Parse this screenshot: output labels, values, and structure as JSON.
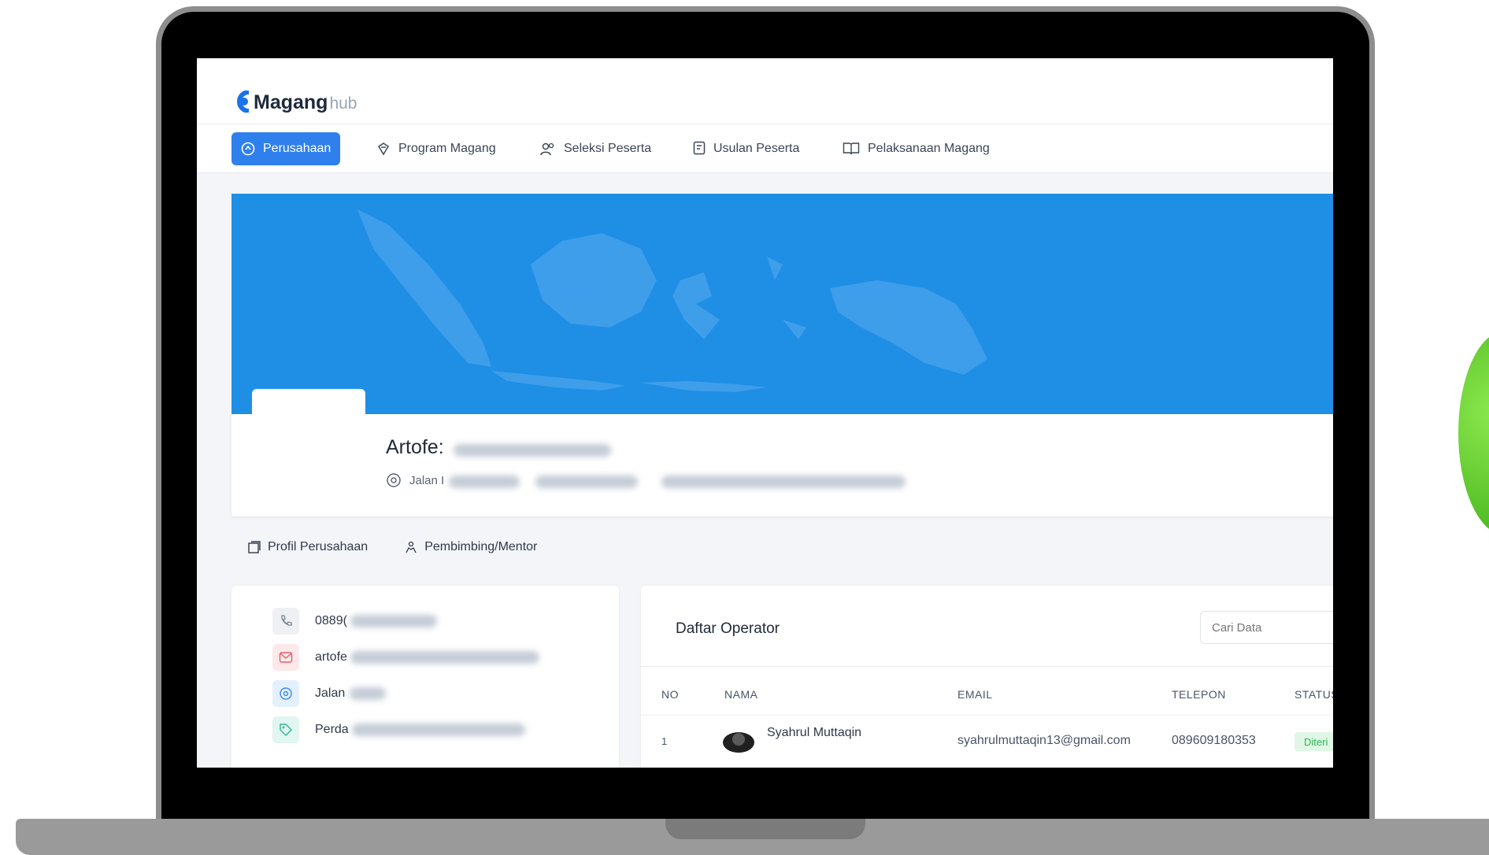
{
  "brand": {
    "name_main": "Magang",
    "name_sub": "hub"
  },
  "nav": {
    "items": [
      {
        "label": "Perusahaan",
        "icon": "dashboard-icon",
        "active": true
      },
      {
        "label": "Program Magang",
        "icon": "badge-icon",
        "active": false
      },
      {
        "label": "Seleksi Peserta",
        "icon": "users-icon",
        "active": false
      },
      {
        "label": "Usulan Peserta",
        "icon": "document-icon",
        "active": false
      },
      {
        "label": "Pelaksanaan Magang",
        "icon": "book-icon",
        "active": false
      }
    ]
  },
  "company": {
    "name_visible": "Artofe:",
    "address_visible": "Jalan I"
  },
  "subtabs": [
    {
      "label": "Profil Perusahaan",
      "icon": "building-icon"
    },
    {
      "label": "Pembimbing/Mentor",
      "icon": "mentor-icon"
    }
  ],
  "contacts": [
    {
      "text": "0889(",
      "icon": "phone-icon"
    },
    {
      "text": "artofe",
      "icon": "mail-icon"
    },
    {
      "text": "Jalan",
      "icon": "location-icon"
    },
    {
      "text": "Perda",
      "icon": "tag-icon"
    }
  ],
  "operators": {
    "title": "Daftar Operator",
    "search_placeholder": "Cari Data",
    "columns": [
      "NO",
      "NAMA",
      "EMAIL",
      "TELEPON",
      "STATUS"
    ],
    "rows": [
      {
        "no": "1",
        "nama": "Syahrul Muttaqin",
        "email": "syahrulmuttaqin13@gmail.com",
        "telepon": "089609180353",
        "status": "Diteri"
      }
    ]
  },
  "colors": {
    "accent": "#2f80ed",
    "hero": "#1f8fe5",
    "status_green": "#34b25a"
  }
}
